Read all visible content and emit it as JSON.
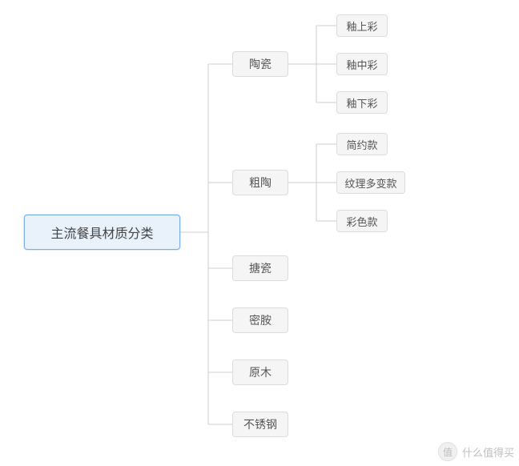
{
  "root": {
    "label": "主流餐具材质分类"
  },
  "categories": [
    {
      "key": "ceramic",
      "label": "陶瓷",
      "subs": [
        {
          "key": "overglaze",
          "label": "釉上彩"
        },
        {
          "key": "inglaze",
          "label": "釉中彩"
        },
        {
          "key": "underglaze",
          "label": "釉下彩"
        }
      ]
    },
    {
      "key": "stoneware",
      "label": "粗陶",
      "subs": [
        {
          "key": "minimal",
          "label": "简约款"
        },
        {
          "key": "textured",
          "label": "纹理多变款"
        },
        {
          "key": "colored",
          "label": "彩色款"
        }
      ]
    },
    {
      "key": "enamel",
      "label": "搪瓷",
      "subs": []
    },
    {
      "key": "melamine",
      "label": "密胺",
      "subs": []
    },
    {
      "key": "wood",
      "label": "原木",
      "subs": []
    },
    {
      "key": "stainless",
      "label": "不锈钢",
      "subs": []
    }
  ],
  "watermark": {
    "icon": "值",
    "text": "什么值得买"
  },
  "colors": {
    "rootBg": "#e9f2fb",
    "rootBorder": "#7aaee0",
    "nodeBg": "#f5f5f5",
    "nodeBorder": "#dcdcdc",
    "connector": "#cfcfcf"
  }
}
